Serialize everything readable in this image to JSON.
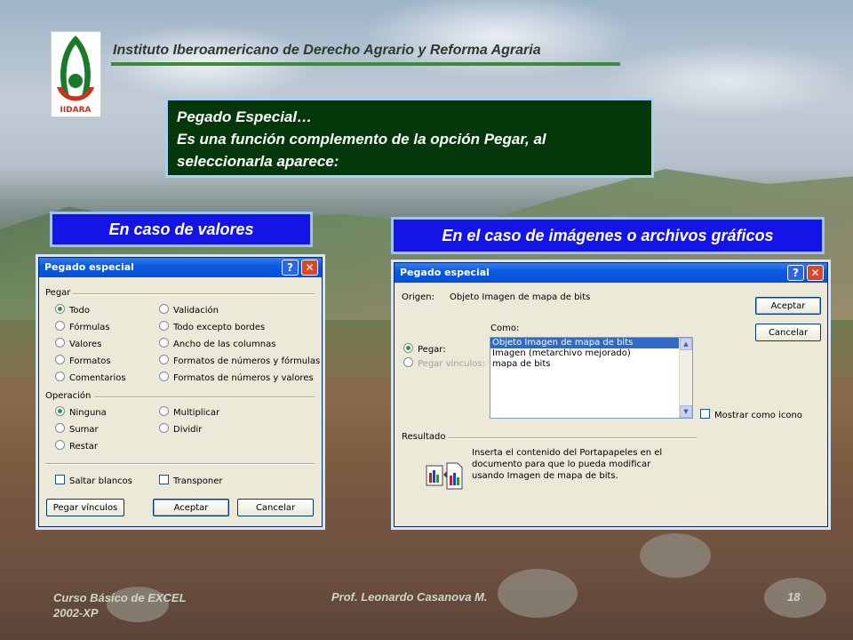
{
  "header": {
    "institute": "Instituto Iberoamericano de Derecho Agrario y Reforma Agraria",
    "logo_text": "IIDARA"
  },
  "title_box": {
    "line1": "Pegado Especial…",
    "line2": "Es una función complemento de la opción Pegar, al",
    "line3": "seleccionarla aparece:"
  },
  "labels": {
    "values_case": "En caso de valores",
    "images_case": "En el caso de imágenes o archivos gráficos"
  },
  "dialog1": {
    "title": "Pegado especial",
    "help": "?",
    "close": "✕",
    "group_paste": "Pegar",
    "paste_options": [
      {
        "label": "Todo",
        "checked": true
      },
      {
        "label": "Fórmulas",
        "checked": false
      },
      {
        "label": "Valores",
        "checked": false
      },
      {
        "label": "Formatos",
        "checked": false
      },
      {
        "label": "Comentarios",
        "checked": false
      },
      {
        "label": "Validación",
        "checked": false
      },
      {
        "label": "Todo excepto bordes",
        "checked": false
      },
      {
        "label": "Ancho de las columnas",
        "checked": false
      },
      {
        "label": "Formatos de números y fórmulas",
        "checked": false
      },
      {
        "label": "Formatos de números y valores",
        "checked": false
      }
    ],
    "group_operation": "Operación",
    "operation_options": [
      {
        "label": "Ninguna",
        "checked": true
      },
      {
        "label": "Sumar",
        "checked": false
      },
      {
        "label": "Restar",
        "checked": false
      },
      {
        "label": "Multiplicar",
        "checked": false
      },
      {
        "label": "Dividir",
        "checked": false
      }
    ],
    "skip_blanks": "Saltar blancos",
    "transpose": "Transponer",
    "btn_paste_link": "Pegar vínculos",
    "btn_ok": "Aceptar",
    "btn_cancel": "Cancelar"
  },
  "dialog2": {
    "title": "Pegado especial",
    "help": "?",
    "close": "✕",
    "origin_label": "Origen:",
    "origin_value": "Objeto Imagen de mapa de bits",
    "as_label": "Como:",
    "paste_radio": "Pegar:",
    "paste_link_radio": "Pegar vínculos:",
    "list_items": [
      "Objeto Imagen de mapa de bits",
      "Imagen (metarchivo mejorado)",
      "mapa de bits"
    ],
    "selected_index": 0,
    "show_icon": "Mostrar como icono",
    "btn_ok": "Aceptar",
    "btn_cancel": "Cancelar",
    "result_label": "Resultado",
    "result_line1": "Inserta el contenido del Portapapeles en el",
    "result_line2": "documento para que lo pueda modificar",
    "result_line3": "usando Imagen de mapa de bits."
  },
  "footer": {
    "course_line1": "Curso Básico de EXCEL",
    "course_line2": "2002-XP",
    "teacher": "Prof. Leonardo Casanova M.",
    "page": "18"
  }
}
